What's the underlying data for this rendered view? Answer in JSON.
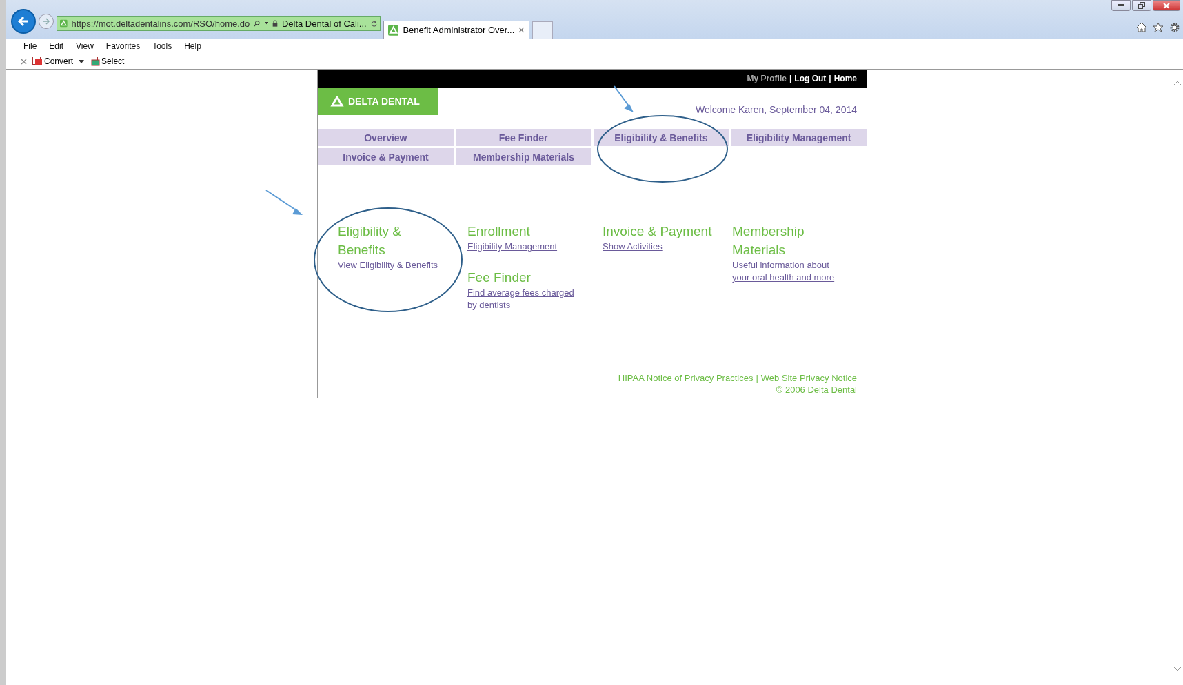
{
  "browser": {
    "url": "https://mot.deltadentalins.com/RSO/home.do",
    "site_identity": "Delta Dental of Cali...",
    "tab_title": "Benefit Administrator Over...",
    "menu": [
      "File",
      "Edit",
      "View",
      "Favorites",
      "Tools",
      "Help"
    ],
    "toolbar": [
      "Convert",
      "Select"
    ]
  },
  "page": {
    "top_links": [
      {
        "label": "My Profile",
        "dimmed": true
      },
      {
        "label": "Log Out",
        "dimmed": false
      },
      {
        "label": "Home",
        "dimmed": false
      }
    ],
    "logo": "DELTA DENTAL",
    "welcome": "Welcome Karen, September 04, 2014",
    "nav": [
      [
        "Overview",
        "Fee Finder",
        "Eligibility & Benefits",
        "Eligibility Management"
      ],
      [
        "Invoice & Payment",
        "Membership Materials"
      ]
    ],
    "sections": [
      {
        "items": [
          {
            "heading": "Eligibility & Benefits",
            "link": "View Eligibility & Benefits"
          }
        ]
      },
      {
        "items": [
          {
            "heading": "Enrollment",
            "link": "Eligibility Management"
          },
          {
            "heading": "Fee Finder",
            "link": "Find average fees charged by dentists"
          }
        ]
      },
      {
        "items": [
          {
            "heading": "Invoice & Payment",
            "link": "Show Activities"
          }
        ]
      },
      {
        "items": [
          {
            "heading": "Membership Materials",
            "link": "Useful information about your oral health and more"
          }
        ]
      }
    ],
    "footer_links": [
      "HIPAA Notice of Privacy Practices",
      "Web Site Privacy Notice"
    ],
    "separator": "|",
    "copyright": "© 2006 Delta Dental"
  }
}
